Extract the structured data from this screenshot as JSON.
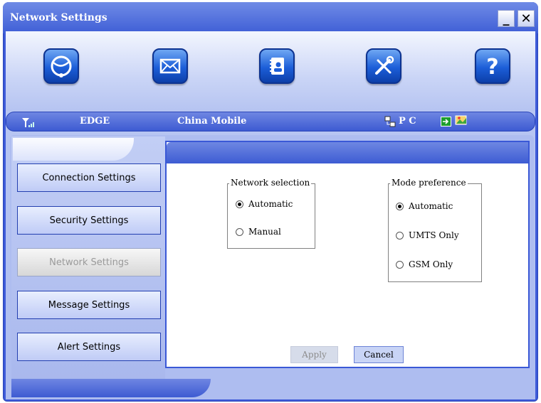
{
  "window": {
    "title": "Network Settings",
    "minimize_icon": "minimize-icon",
    "close_icon": "close-icon"
  },
  "toolbar": {
    "items": [
      {
        "name": "internet-connect",
        "icon": "globe-icon"
      },
      {
        "name": "messages",
        "icon": "envelope-icon"
      },
      {
        "name": "phonebook",
        "icon": "contacts-icon"
      },
      {
        "name": "settings",
        "icon": "tools-icon"
      },
      {
        "name": "help",
        "icon": "help-icon"
      }
    ]
  },
  "status": {
    "signal_icon": "signal-bars-icon",
    "network_type": "EDGE",
    "operator": "China Mobile",
    "mode": "P C",
    "mode_icon": "pc-connection-icon",
    "indicators": [
      "sim-icon",
      "image-icon"
    ]
  },
  "sidebar": {
    "items": [
      {
        "label": "Connection Settings"
      },
      {
        "label": "Security Settings"
      },
      {
        "label": "Network Settings",
        "active": true
      },
      {
        "label": "Message Settings"
      },
      {
        "label": "Alert Settings"
      }
    ]
  },
  "network_selection": {
    "legend": "Network selection",
    "options": [
      {
        "label": "Automatic",
        "selected": true
      },
      {
        "label": "Manual",
        "selected": false
      }
    ]
  },
  "mode_preference": {
    "legend": "Mode preference",
    "options": [
      {
        "label": "Automatic",
        "selected": true
      },
      {
        "label": "UMTS Only",
        "selected": false
      },
      {
        "label": "GSM Only",
        "selected": false
      }
    ]
  },
  "actions": {
    "apply_label": "Apply",
    "cancel_label": "Cancel"
  },
  "colors": {
    "frame": "#3d5ad8",
    "panel_header": "#3d5cd3",
    "button_bg": "#c8d4f6"
  }
}
